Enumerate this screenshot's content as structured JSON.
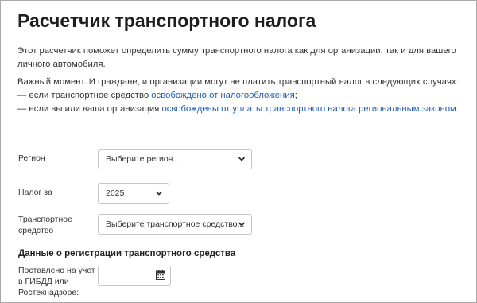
{
  "page": {
    "title": "Расчетчик транспортного налога",
    "intro_line1": "Этот расчетчик поможет определить сумму транспортного налога как для организации, так и для вашего",
    "intro_line2": "личного автомобиля.",
    "important": "Важный момент. И граждане, и организации могут не платить транспортный налог в следующих случаях:",
    "case1_prefix": "— если транспортное средство ",
    "case1_link": "освобождено от налогообложения",
    "case1_suffix": ";",
    "case2_prefix": "— если вы или ваша организация ",
    "case2_link": "освобождены от уплаты транспортного налога региональным законом",
    "case2_suffix": "."
  },
  "form": {
    "region": {
      "label": "Регион",
      "value": "Выберите регион...",
      "icon": "chevron-down-icon"
    },
    "year": {
      "label": "Налог за",
      "value": "2025",
      "icon": "chevron-down-icon"
    },
    "vehicle": {
      "label_line1": "Транспортное",
      "label_line2": "средство",
      "value": "Выберите транспортное средство...",
      "icon": "chevron-down-icon"
    },
    "registration": {
      "section_title": "Данные о регистрации транспортного средства",
      "label_line1": "Поставлено на учет",
      "label_line2": "в ГИБДД или",
      "label_line3": "Ростехнадзоре:",
      "value": "",
      "icon": "calendar-icon"
    }
  },
  "colors": {
    "link": "#1f5fa8",
    "text": "#333333",
    "border": "#c7c7c7"
  }
}
